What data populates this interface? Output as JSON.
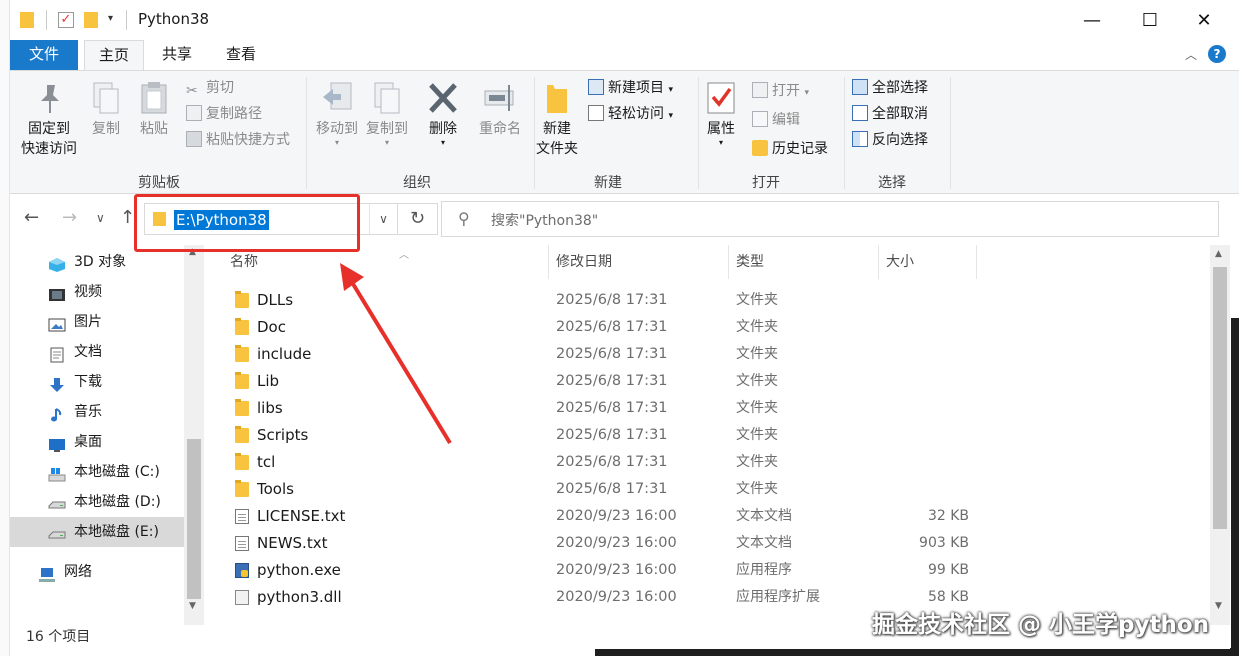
{
  "window": {
    "title": "Python38",
    "controls": {
      "minimize": "—",
      "maximize": "☐",
      "close": "✕"
    }
  },
  "ribbon_tabs": [
    "文件",
    "主页",
    "共享",
    "查看"
  ],
  "ribbon": {
    "clipboard": {
      "pin_line1": "固定到",
      "pin_line2": "快速访问",
      "copy": "复制",
      "paste": "粘贴",
      "cut": "剪切",
      "copy_path": "复制路径",
      "paste_shortcut": "粘贴快捷方式",
      "group": "剪贴板"
    },
    "organize": {
      "move_to": "移动到",
      "copy_to": "复制到",
      "delete": "删除",
      "rename": "重命名",
      "group": "组织"
    },
    "new": {
      "new_item": "新建项目",
      "easy_access": "轻松访问",
      "new_folder_line1": "新建",
      "new_folder_line2": "文件夹",
      "group": "新建"
    },
    "open": {
      "properties": "属性",
      "open": "打开",
      "edit": "编辑",
      "history": "历史记录",
      "group": "打开"
    },
    "select": {
      "select_all": "全部选择",
      "select_none": "全部取消",
      "invert": "反向选择",
      "group": "选择"
    }
  },
  "address": {
    "path": "E:\\Python38",
    "search_placeholder": "搜索\"Python38\""
  },
  "nav_pane": [
    {
      "label": "3D 对象",
      "icon": "3d-objects-icon"
    },
    {
      "label": "视频",
      "icon": "video-icon"
    },
    {
      "label": "图片",
      "icon": "pictures-icon"
    },
    {
      "label": "文档",
      "icon": "documents-icon"
    },
    {
      "label": "下载",
      "icon": "downloads-icon"
    },
    {
      "label": "音乐",
      "icon": "music-icon"
    },
    {
      "label": "桌面",
      "icon": "desktop-icon"
    },
    {
      "label": "本地磁盘 (C:)",
      "icon": "drive-c-icon"
    },
    {
      "label": "本地磁盘 (D:)",
      "icon": "drive-icon"
    },
    {
      "label": "本地磁盘 (E:)",
      "icon": "drive-icon"
    },
    {
      "label": "网络",
      "icon": "network-icon"
    }
  ],
  "columns": {
    "name": "名称",
    "date": "修改日期",
    "type": "类型",
    "size": "大小"
  },
  "files": [
    {
      "name": "DLLs",
      "date": "2025/6/8 17:31",
      "type": "文件夹",
      "size": "",
      "icon": "folder"
    },
    {
      "name": "Doc",
      "date": "2025/6/8 17:31",
      "type": "文件夹",
      "size": "",
      "icon": "folder"
    },
    {
      "name": "include",
      "date": "2025/6/8 17:31",
      "type": "文件夹",
      "size": "",
      "icon": "folder"
    },
    {
      "name": "Lib",
      "date": "2025/6/8 17:31",
      "type": "文件夹",
      "size": "",
      "icon": "folder"
    },
    {
      "name": "libs",
      "date": "2025/6/8 17:31",
      "type": "文件夹",
      "size": "",
      "icon": "folder"
    },
    {
      "name": "Scripts",
      "date": "2025/6/8 17:31",
      "type": "文件夹",
      "size": "",
      "icon": "folder"
    },
    {
      "name": "tcl",
      "date": "2025/6/8 17:31",
      "type": "文件夹",
      "size": "",
      "icon": "folder"
    },
    {
      "name": "Tools",
      "date": "2025/6/8 17:31",
      "type": "文件夹",
      "size": "",
      "icon": "folder"
    },
    {
      "name": "LICENSE.txt",
      "date": "2020/9/23 16:00",
      "type": "文本文档",
      "size": "32 KB",
      "icon": "doc"
    },
    {
      "name": "NEWS.txt",
      "date": "2020/9/23 16:00",
      "type": "文本文档",
      "size": "903 KB",
      "icon": "doc"
    },
    {
      "name": "python.exe",
      "date": "2020/9/23 16:00",
      "type": "应用程序",
      "size": "99 KB",
      "icon": "exe"
    },
    {
      "name": "python3.dll",
      "date": "2020/9/23 16:00",
      "type": "应用程序扩展",
      "size": "58 KB",
      "icon": "dll"
    }
  ],
  "status": "16 个项目",
  "watermark": "掘金技术社区 @ 小王学python",
  "colors": {
    "accent": "#1979ca",
    "selection": "#0078d7",
    "highlight_red": "#e8302b",
    "folder": "#f8c440"
  }
}
